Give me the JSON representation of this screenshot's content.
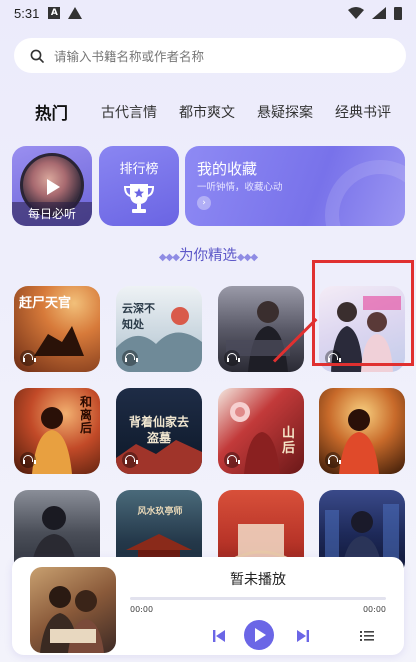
{
  "status_bar": {
    "time": "5:31",
    "icons": [
      "a-icon",
      "warning-icon",
      "wifi-icon",
      "signal-icon",
      "battery-icon"
    ]
  },
  "search": {
    "placeholder": "请输入书籍名称或作者名称",
    "icon": "search-icon"
  },
  "tabs": [
    {
      "label": "热门",
      "active": true
    },
    {
      "label": "古代言情",
      "active": false
    },
    {
      "label": "都市爽文",
      "active": false
    },
    {
      "label": "悬疑探案",
      "active": false
    },
    {
      "label": "经典书评",
      "active": false
    }
  ],
  "quick_cards": {
    "daily": {
      "label": "每日必听"
    },
    "rank": {
      "label": "排行榜"
    },
    "favorites": {
      "title": "我的收藏",
      "subtitle": "一听钟情，收藏心动"
    }
  },
  "section": {
    "title": "为你精选",
    "deco_left": "◆◆◆",
    "deco_right": "◆◆◆"
  },
  "covers": [
    {
      "text": "赶尸天官",
      "palette": [
        "#d77a3a",
        "#8a3a20"
      ]
    },
    {
      "text": "云深不知处",
      "palette": [
        "#dfe8ee",
        "#b9c9d4"
      ]
    },
    {
      "text": "",
      "palette": [
        "#6a6a7a",
        "#2f2f3a"
      ]
    },
    {
      "text": "",
      "palette": [
        "#f1e8f4",
        "#c7d1ee"
      ]
    },
    {
      "text": "和离后",
      "palette": [
        "#c24a28",
        "#6a2010"
      ]
    },
    {
      "text": "背着仙家去盗墓",
      "palette": [
        "#23344f",
        "#0d1828"
      ]
    },
    {
      "text": "山后",
      "palette": [
        "#c23a3a",
        "#6a1818"
      ]
    },
    {
      "text": "",
      "palette": [
        "#c86a2a",
        "#5a2a10"
      ]
    },
    {
      "text": "",
      "palette": [
        "#6a6e78",
        "#2a2e38"
      ]
    },
    {
      "text": "风水玖亭师",
      "palette": [
        "#3a5a6a",
        "#1a2a38"
      ]
    },
    {
      "text": "",
      "palette": [
        "#c8443a",
        "#8a2018"
      ]
    },
    {
      "text": "",
      "palette": [
        "#2a3a6a",
        "#121a38"
      ]
    }
  ],
  "player": {
    "status": "暂未播放",
    "time_current": "00:00",
    "time_total": "00:00",
    "progress": 0
  },
  "colors": {
    "accent": "#6b66e6",
    "highlight": "#e03030"
  }
}
